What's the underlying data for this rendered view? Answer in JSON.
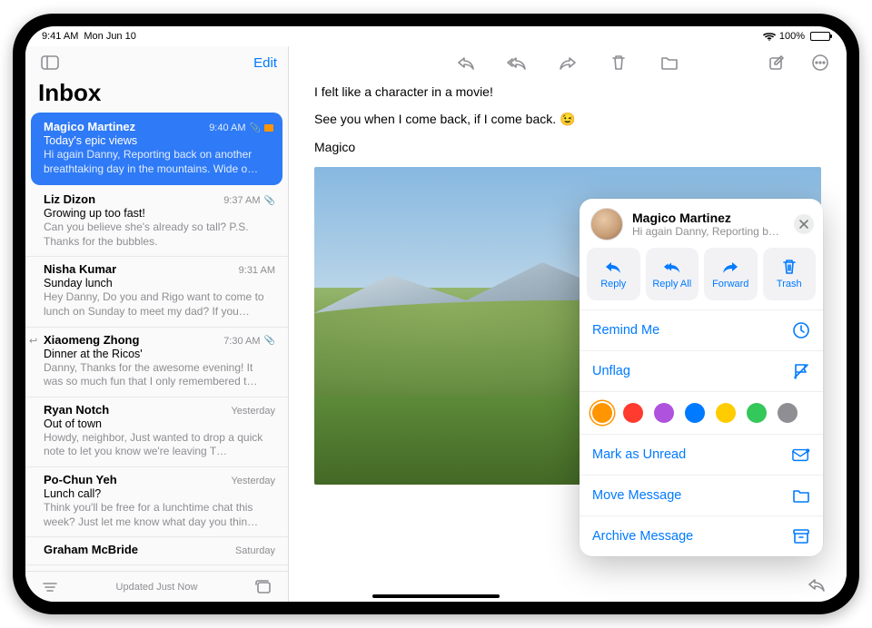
{
  "status": {
    "time": "9:41 AM",
    "date": "Mon Jun 10",
    "battery": "100%"
  },
  "sidebar": {
    "edit": "Edit",
    "title": "Inbox",
    "updated": "Updated Just Now"
  },
  "messages": [
    {
      "sender": "Magico Martinez",
      "time": "9:40 AM",
      "subject": "Today's epic views",
      "preview": "Hi again Danny, Reporting back on another breathtaking day in the mountains. Wide o…",
      "selected": true,
      "flagged": true,
      "attachment": true
    },
    {
      "sender": "Liz Dizon",
      "time": "9:37 AM",
      "subject": "Growing up too fast!",
      "preview": "Can you believe she's already so tall? P.S. Thanks for the bubbles.",
      "attachment": true
    },
    {
      "sender": "Nisha Kumar",
      "time": "9:31 AM",
      "subject": "Sunday lunch",
      "preview": "Hey Danny, Do you and Rigo want to come to lunch on Sunday to meet my dad? If you…"
    },
    {
      "sender": "Xiaomeng Zhong",
      "time": "7:30 AM",
      "subject": "Dinner at the Ricos'",
      "preview": "Danny, Thanks for the awesome evening! It was so much fun that I only remembered t…",
      "replied": true,
      "attachment": true
    },
    {
      "sender": "Ryan Notch",
      "time": "Yesterday",
      "subject": "Out of town",
      "preview": "Howdy, neighbor, Just wanted to drop a quick note to let you know we're leaving T…"
    },
    {
      "sender": "Po-Chun Yeh",
      "time": "Yesterday",
      "subject": "Lunch call?",
      "preview": "Think you'll be free for a lunchtime chat this week? Just let me know what day you thin…"
    },
    {
      "sender": "Graham McBride",
      "time": "Saturday",
      "subject": "",
      "preview": ""
    }
  ],
  "body": {
    "line1": "I felt like a character in a movie!",
    "line2": "See you when I come back, if I come back. 😉",
    "signoff": "Magico"
  },
  "popover": {
    "name": "Magico Martinez",
    "preview": "Hi again Danny, Reporting back o…",
    "actions": {
      "reply": "Reply",
      "reply_all": "Reply All",
      "forward": "Forward",
      "trash": "Trash"
    },
    "remind": "Remind Me",
    "unflag": "Unflag",
    "flag_colors": [
      "#ff9500",
      "#ff3b30",
      "#af52de",
      "#007aff",
      "#ffcc00",
      "#34c759",
      "#8e8e93"
    ],
    "mark_unread": "Mark as Unread",
    "move": "Move Message",
    "archive": "Archive Message"
  }
}
